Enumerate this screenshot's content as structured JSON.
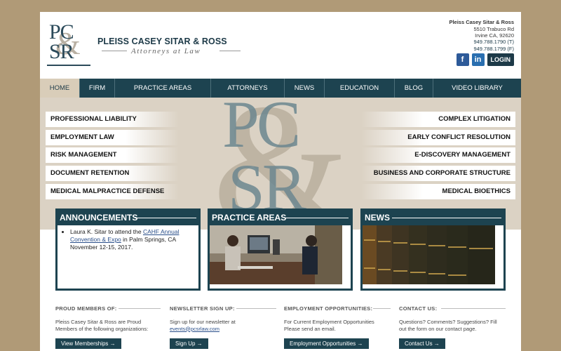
{
  "header": {
    "logo_top": "PC",
    "logo_bottom": "SR",
    "logo_amp": "&",
    "firm_name": "PLEISS CASEY SITAR & ROSS",
    "tagline": "Attorneys at Law",
    "address": {
      "name": "Pleiss Casey Sitar & Ross",
      "street": "5510 Trabuco Rd",
      "city": "Irvine CA, 92620"
    },
    "phone_t": "949.788.1790 (T)",
    "phone_f": "949.788.1799 (F)",
    "facebook_icon": "f",
    "linkedin_icon": "in",
    "login_label": "LOGIN"
  },
  "nav": {
    "items": [
      "HOME",
      "FIRM",
      "PRACTICE AREAS",
      "ATTORNEYS",
      "NEWS",
      "EDUCATION",
      "BLOG",
      "VIDEO LIBRARY"
    ]
  },
  "hero": {
    "left_links": [
      "PROFESSIONAL LIABILITY",
      "EMPLOYMENT LAW",
      "RISK MANAGEMENT",
      "DOCUMENT RETENTION",
      "MEDICAL MALPRACTICE DEFENSE"
    ],
    "right_links": [
      "COMPLEX LITIGATION",
      "EARLY CONFLICT RESOLUTION",
      "E-DISCOVERY MANAGEMENT",
      "BUSINESS AND CORPORATE STRUCTURE",
      "MEDICAL BIOETHICS"
    ]
  },
  "boxes": {
    "announcements": {
      "title": "ANNOUNCEMENTS",
      "item_prefix": "Laura K. Sitar to attend the ",
      "item_link": "CAHF Annual Convention & Expo",
      "item_suffix": " in Palm Springs, CA November 12-15, 2017."
    },
    "practice_title": "PRACTICE AREAS",
    "news_title": "NEWS"
  },
  "footer": {
    "members": {
      "heading": "PROUD MEMBERS OF:",
      "text": "Pleiss Casey Sitar & Ross are Proud Members of the following organizations:",
      "button": "View Memberships →"
    },
    "newsletter": {
      "heading": "NEWSLETTER SIGN UP:",
      "text": "Sign up for our newsletter at",
      "email": "events@pcsrlaw.com",
      "button": "Sign Up →"
    },
    "employment": {
      "heading": "EMPLOYMENT OPPORTUNITIES:",
      "text": "For Current Employment Opportunities Please send an email.",
      "button": "Employment Opportunities →"
    },
    "contact": {
      "heading": "CONTACT US:",
      "text": "Questions? Comments? Suggestions? Fill out the form on our contact page.",
      "button": "Contact Us →"
    }
  },
  "colors": {
    "brand_teal": "#1d4350",
    "page_background": "#b09a77",
    "hero_background": "#dbd2c4"
  }
}
